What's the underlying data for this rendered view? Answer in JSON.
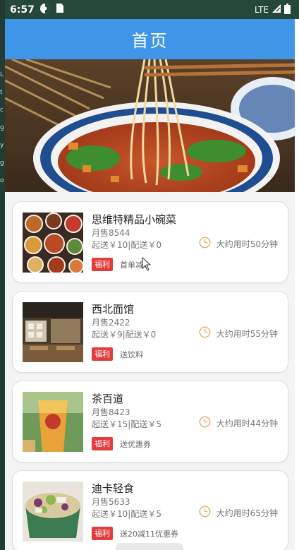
{
  "status_bar": {
    "time": "6:57",
    "network": "LTE",
    "icons": [
      "vpn-key-icon",
      "sim-card-icon",
      "signal-icon",
      "battery-icon"
    ]
  },
  "app_bar": {
    "title": "首页"
  },
  "hero": {
    "image": "noodle-bowl-banner"
  },
  "colors": {
    "app_bar": "#3f95e8",
    "status_bar": "#24483a",
    "welfare_tag": "#e23c3c",
    "clock_icon": "#e0b472"
  },
  "restaurants": [
    {
      "name": "思维特精品小碗菜",
      "monthly_sales": "月售8544",
      "fees": "起送￥10|配送￥0",
      "tag": "福利",
      "promo": "首单减6",
      "eta": "大约用时50分钟",
      "image": "dishes-spread-photo"
    },
    {
      "name": "西北面馆",
      "monthly_sales": "月售2422",
      "fees": "起送￥9|配送￥0",
      "tag": "福利",
      "promo": "送饮料",
      "eta": "大约用时55分钟",
      "image": "restaurant-interior-photo"
    },
    {
      "name": "茶百道",
      "monthly_sales": "月售8423",
      "fees": "起送￥15|配送￥5",
      "tag": "福利",
      "promo": "送优惠券",
      "eta": "大约用时44分钟",
      "image": "fruit-tea-cup-photo"
    },
    {
      "name": "迪卡轻食",
      "monthly_sales": "月售5633",
      "fees": "起送￥10|配送￥5",
      "tag": "福利",
      "promo": "送20减11优惠券",
      "eta": "大约用时65分钟",
      "image": "salad-bowl-photo"
    }
  ]
}
